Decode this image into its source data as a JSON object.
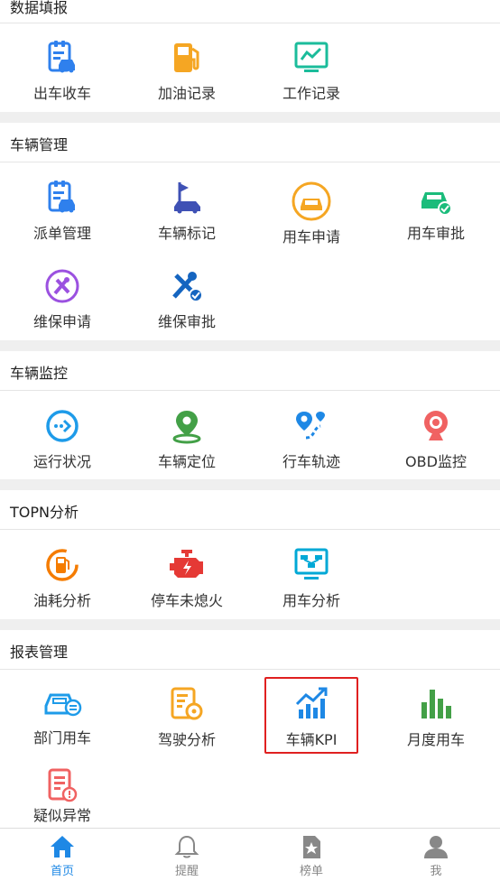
{
  "sections": {
    "data_entry": {
      "title": "数据填报",
      "items": [
        "出车收车",
        "加油记录",
        "工作记录"
      ]
    },
    "vehicle_management": {
      "title": "车辆管理",
      "items": [
        "派单管理",
        "车辆标记",
        "用车申请",
        "用车审批",
        "维保申请",
        "维保审批"
      ]
    },
    "vehicle_monitoring": {
      "title": "车辆监控",
      "items": [
        "运行状况",
        "车辆定位",
        "行车轨迹",
        "OBD监控"
      ]
    },
    "topn_analysis": {
      "title": "TOPN分析",
      "items": [
        "油耗分析",
        "停车未熄火",
        "用车分析"
      ]
    },
    "reports": {
      "title": "报表管理",
      "items": [
        "部门用车",
        "驾驶分析",
        "车辆KPI",
        "月度用车",
        "疑似异常"
      ]
    }
  },
  "tabbar": {
    "items": [
      "首页",
      "提醒",
      "榜单",
      "我"
    ],
    "active_index": 0
  },
  "colors": {
    "active": "#1e88e5",
    "inactive": "#888888",
    "highlight_border": "#e02020"
  }
}
